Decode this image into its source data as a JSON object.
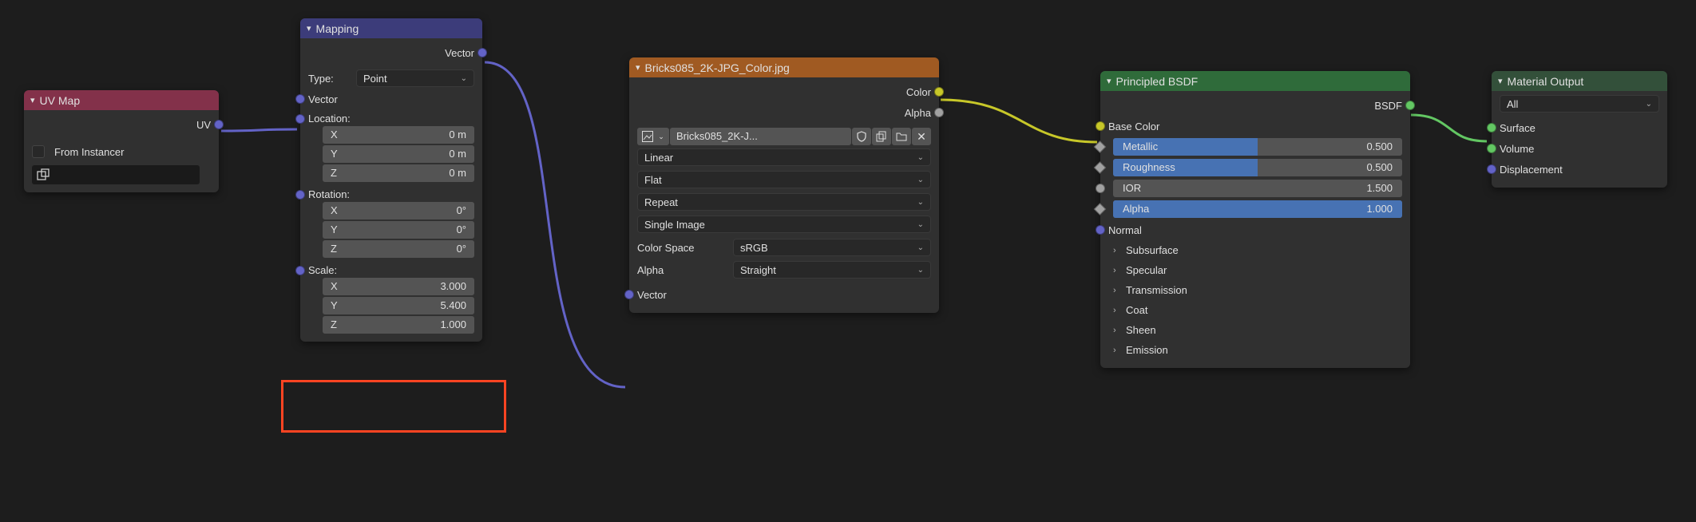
{
  "uvmap": {
    "title": "UV Map",
    "out_uv": "UV",
    "from_instancer": "From Instancer"
  },
  "mapping": {
    "title": "Mapping",
    "out_vector": "Vector",
    "type_label": "Type:",
    "type_value": "Point",
    "in_vector": "Vector",
    "location_label": "Location:",
    "location": {
      "x_label": "X",
      "x": "0 m",
      "y_label": "Y",
      "y": "0 m",
      "z_label": "Z",
      "z": "0 m"
    },
    "rotation_label": "Rotation:",
    "rotation": {
      "x_label": "X",
      "x": "0°",
      "y_label": "Y",
      "y": "0°",
      "z_label": "Z",
      "z": "0°"
    },
    "scale_label": "Scale:",
    "scale": {
      "x_label": "X",
      "x": "3.000",
      "y_label": "Y",
      "y": "5.400",
      "z_label": "Z",
      "z": "1.000"
    }
  },
  "image_tex": {
    "title": "Bricks085_2K-JPG_Color.jpg",
    "out_color": "Color",
    "out_alpha": "Alpha",
    "image_name": "Bricks085_2K-J...",
    "interpolation": "Linear",
    "projection": "Flat",
    "extension": "Repeat",
    "source": "Single Image",
    "color_space_label": "Color Space",
    "color_space": "sRGB",
    "alpha_label": "Alpha",
    "alpha_mode": "Straight",
    "in_vector": "Vector"
  },
  "principled": {
    "title": "Principled BSDF",
    "out_bsdf": "BSDF",
    "base_color": "Base Color",
    "sliders": {
      "metallic": {
        "label": "Metallic",
        "value": "0.500",
        "fill": 50
      },
      "roughness": {
        "label": "Roughness",
        "value": "0.500",
        "fill": 50
      },
      "ior": {
        "label": "IOR",
        "value": "1.500",
        "fill": 0
      },
      "alpha": {
        "label": "Alpha",
        "value": "1.000",
        "fill": 100
      }
    },
    "normal": "Normal",
    "groups": [
      "Subsurface",
      "Specular",
      "Transmission",
      "Coat",
      "Sheen",
      "Emission"
    ]
  },
  "mat_output": {
    "title": "Material Output",
    "target": "All",
    "surface": "Surface",
    "volume": "Volume",
    "displacement": "Displacement"
  },
  "colors": {
    "wire_vector": "#6363c7",
    "wire_color": "#c7c729",
    "wire_shader": "#63c763"
  }
}
